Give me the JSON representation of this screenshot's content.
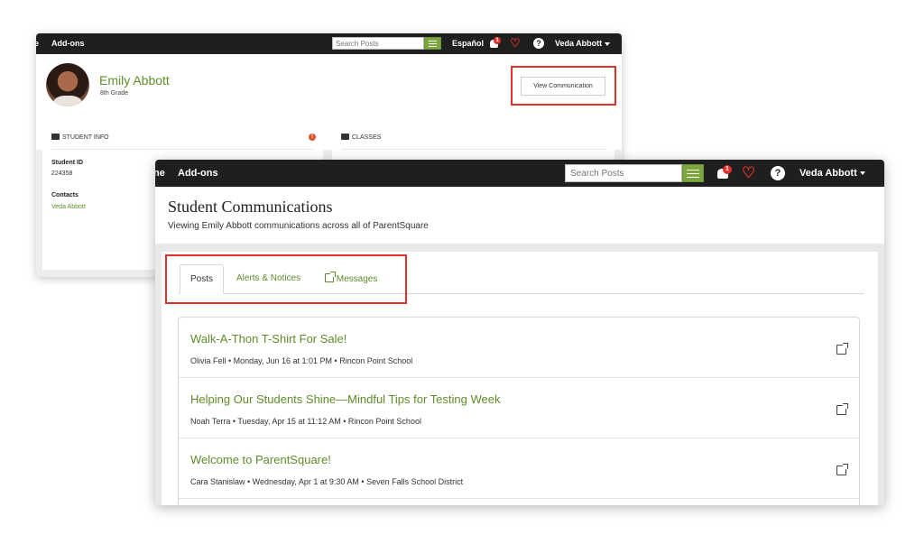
{
  "back_window": {
    "nav": {
      "home_fragment": "e",
      "addons": "Add-ons"
    },
    "search": {
      "placeholder": "Search Posts"
    },
    "language": "Español",
    "notifications": {
      "count": "1"
    },
    "help": "?",
    "user_name": "Veda Abbott",
    "student": {
      "name": "Emily Abbott",
      "grade": "8th Grade"
    },
    "view_communication_label": "View Communication",
    "student_info": {
      "title": "STUDENT INFO",
      "student_id_label": "Student ID",
      "student_id_value": "224358",
      "contacts_label": "Contacts",
      "contact_name": "Veda Abbott"
    },
    "classes": {
      "title": "CLASSES"
    }
  },
  "front_window": {
    "nav": {
      "home_fragment": "ne",
      "addons": "Add-ons"
    },
    "search": {
      "placeholder": "Search Posts"
    },
    "notifications": {
      "count": "1"
    },
    "help": "?",
    "user_name": "Veda Abbott",
    "page_title": "Student Communications",
    "page_subtitle": "Viewing Emily Abbott communications across all of ParentSquare",
    "tabs": [
      {
        "label": "Posts"
      },
      {
        "label": "Alerts & Notices"
      },
      {
        "label": "Messages"
      }
    ],
    "posts": [
      {
        "title": "Walk-A-Thon T-Shirt For Sale!",
        "meta": "Olivia Fell • Monday, Jun 16 at 1:01 PM • Rincon Point School"
      },
      {
        "title": "Helping Our Students Shine—Mindful Tips for Testing Week",
        "meta": "Noah Terra • Tuesday, Apr 15 at 11:12 AM • Rincon Point School"
      },
      {
        "title": "Welcome to ParentSquare!",
        "meta": "Cara Stanislaw • Wednesday, Apr 1 at 9:30 AM • Seven Falls School District"
      }
    ]
  },
  "colors": {
    "accent_green": "#5f8c2a",
    "topbar": "#1f1f1f",
    "highlight_red": "#e2312d",
    "badge_red": "#e0302b"
  }
}
